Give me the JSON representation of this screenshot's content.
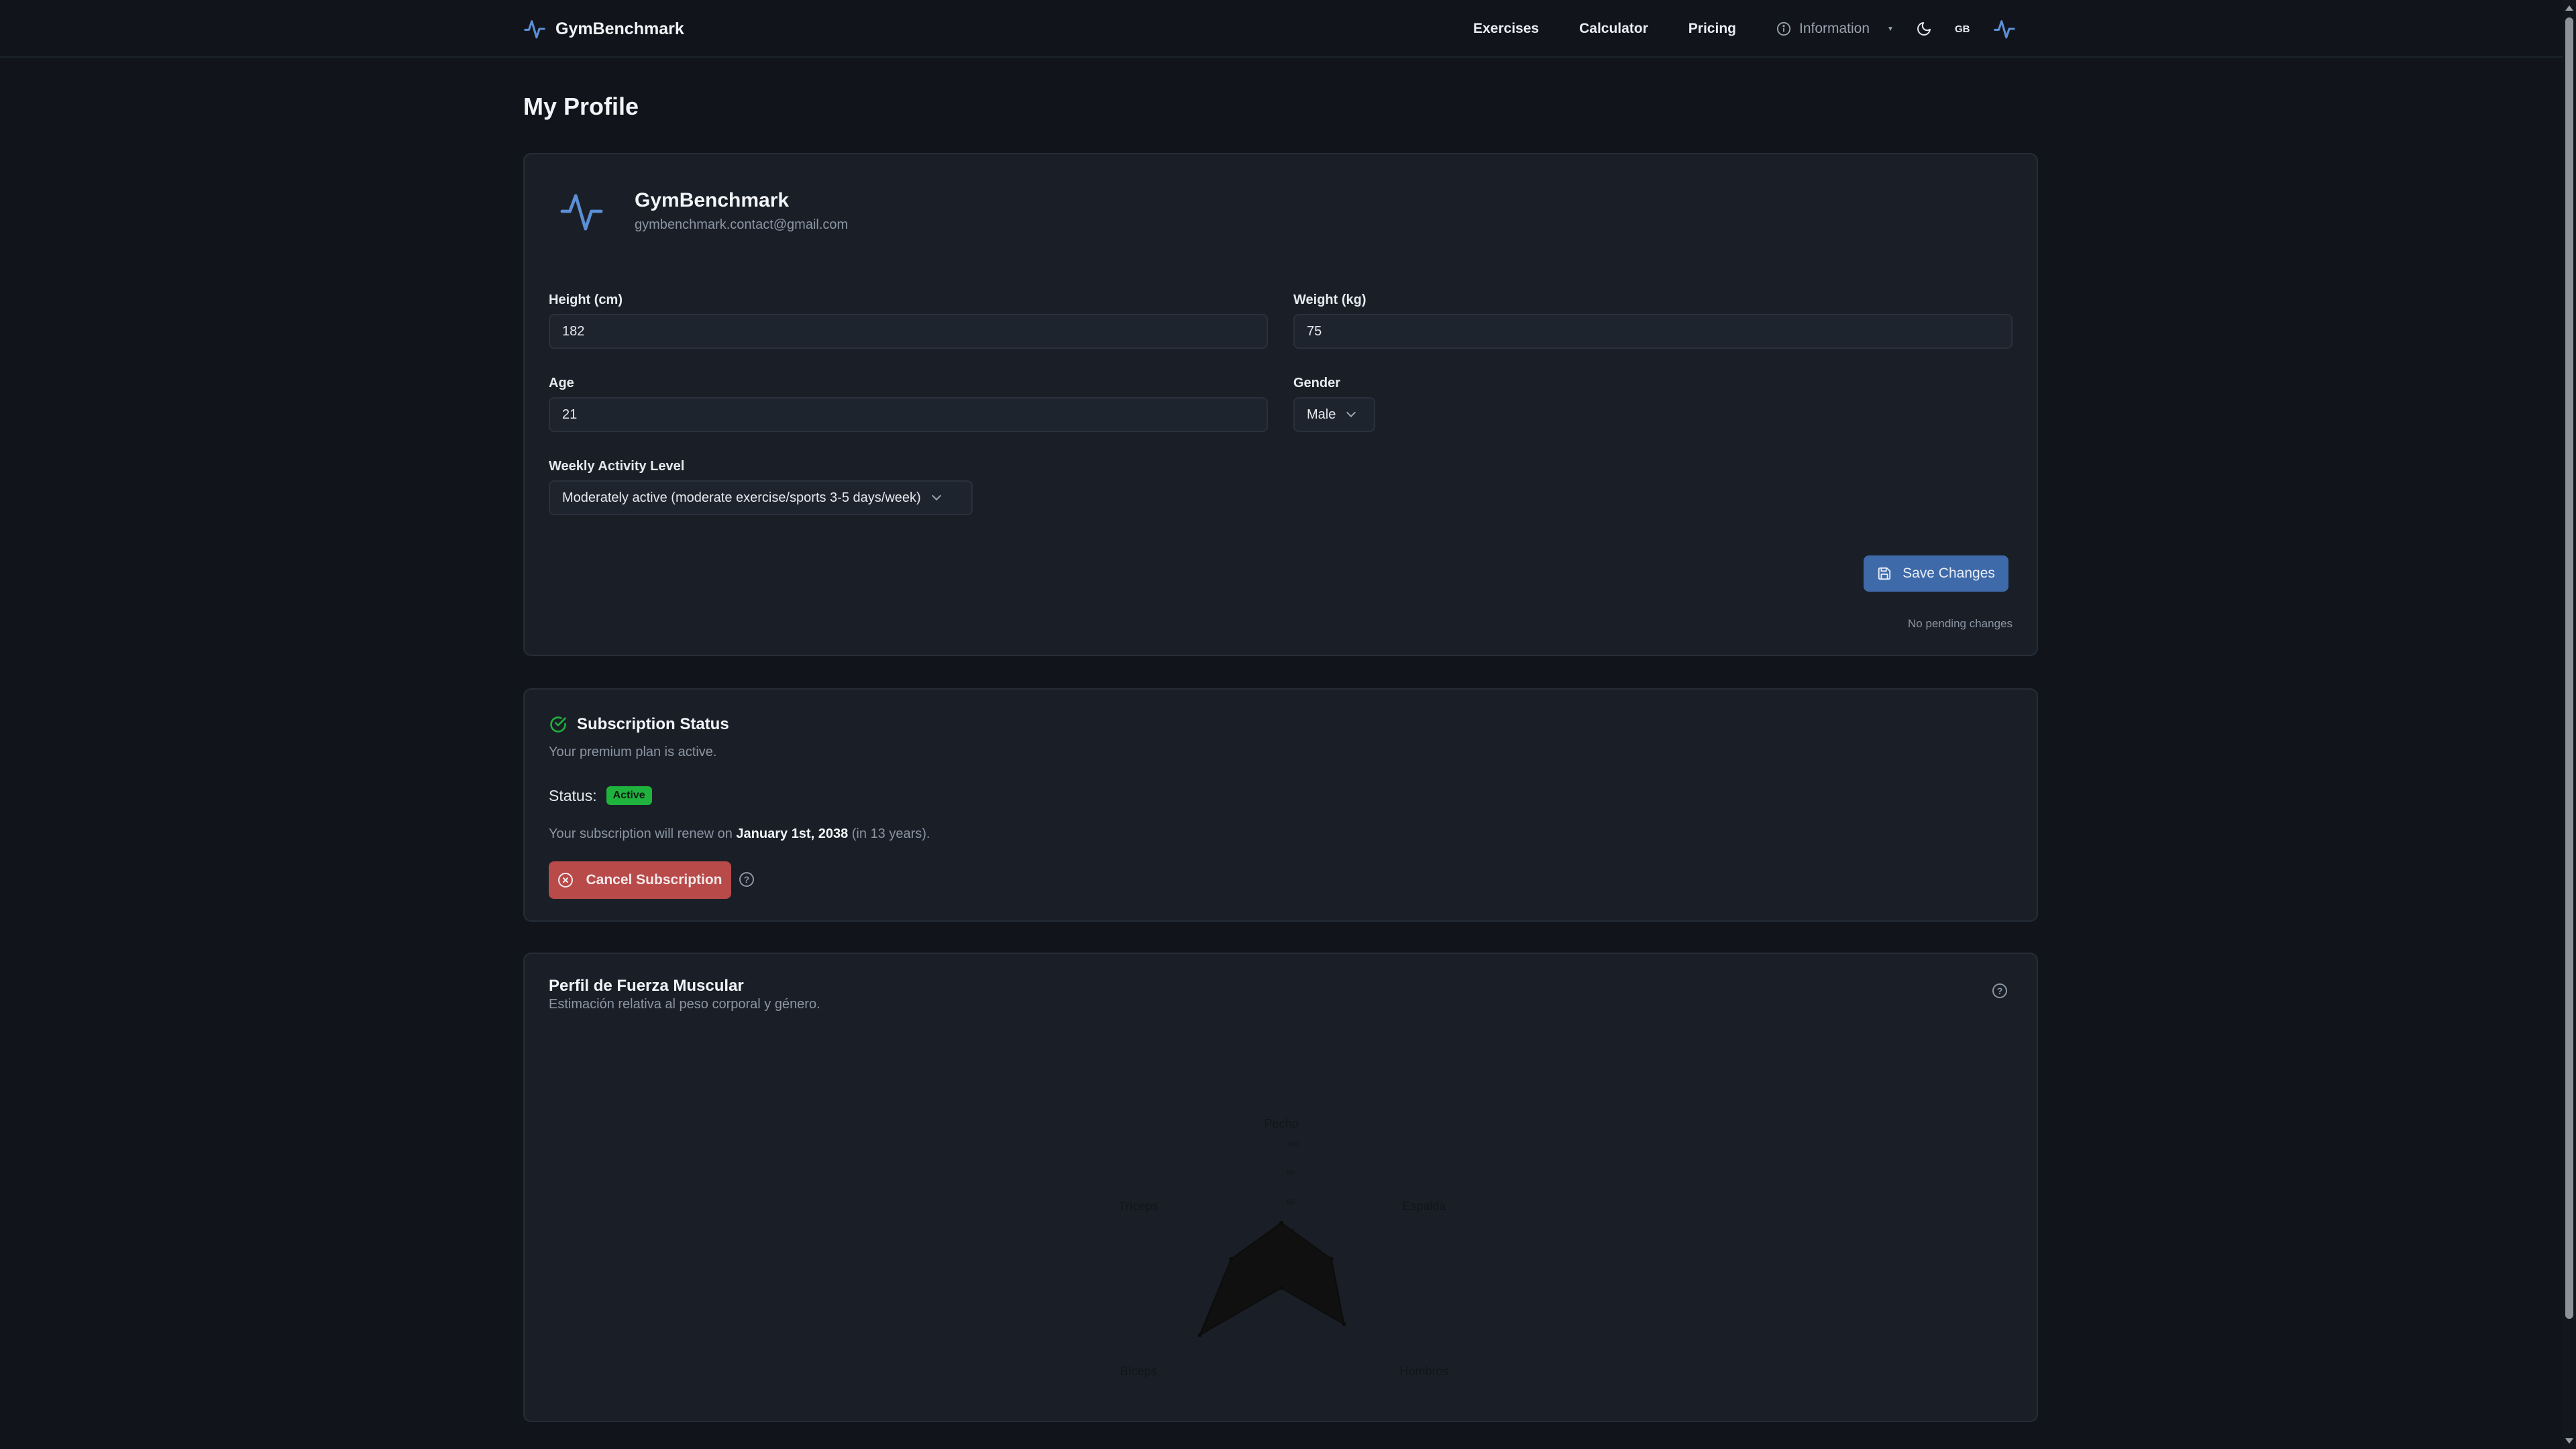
{
  "nav": {
    "brand": "GymBenchmark",
    "links": [
      "Exercises",
      "Calculator",
      "Pricing"
    ],
    "info_label": "Information",
    "lang": "GB"
  },
  "page": {
    "title": "My Profile"
  },
  "profile": {
    "name": "GymBenchmark",
    "email": "gymbenchmark.contact@gmail.com",
    "height_label": "Height (cm)",
    "height_value": "182",
    "weight_label": "Weight (kg)",
    "weight_value": "75",
    "age_label": "Age",
    "age_value": "21",
    "gender_label": "Gender",
    "gender_value": "Male",
    "activity_label": "Weekly Activity Level",
    "activity_value": "Moderately active (moderate exercise/sports 3-5 days/week)",
    "save_label": "Save Changes",
    "pending_text": "No pending changes"
  },
  "subscription": {
    "title": "Subscription Status",
    "description": "Your premium plan is active.",
    "status_label": "Status:",
    "status_badge": "Active",
    "renew_prefix": "Your subscription will renew on",
    "renew_date": "January 1st, 2038",
    "renew_suffix": "(in 13 years).",
    "cancel_label": "Cancel Subscription",
    "help_glyph": "?"
  },
  "strength_chart": {
    "title": "Perfil de Fuerza Muscular",
    "subtitle": "Estimación relativa al peso corporal y género.",
    "help_glyph": "?"
  },
  "chart_data": {
    "type": "radar",
    "categories": [
      "Pecho",
      "Espalda",
      "Hombros",
      "Piernas",
      "Bíceps",
      "Tríceps"
    ],
    "values": [
      45,
      40,
      50,
      0,
      65,
      40
    ],
    "ylim": [
      0,
      100
    ],
    "ticks": [
      "20",
      "40",
      "60",
      "80",
      "100"
    ],
    "fill_color": "#101010"
  },
  "colors": {
    "accent": "#5b8fd6",
    "success": "#1fb33e",
    "danger": "#b84a4a",
    "save": "#3f6aa9"
  }
}
